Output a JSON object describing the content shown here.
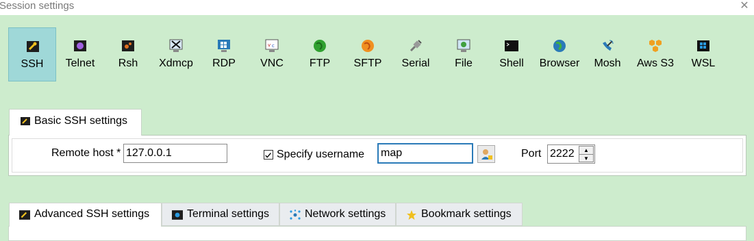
{
  "window": {
    "title": "Session settings",
    "close_glyph": "✕"
  },
  "session_types": [
    {
      "label": "SSH",
      "icon": "ssh-key-icon",
      "active": true
    },
    {
      "label": "Telnet",
      "icon": "telnet-icon"
    },
    {
      "label": "Rsh",
      "icon": "rsh-icon"
    },
    {
      "label": "Xdmcp",
      "icon": "xdmcp-icon"
    },
    {
      "label": "RDP",
      "icon": "rdp-icon"
    },
    {
      "label": "VNC",
      "icon": "vnc-icon"
    },
    {
      "label": "FTP",
      "icon": "ftp-globe-icon"
    },
    {
      "label": "SFTP",
      "icon": "sftp-icon"
    },
    {
      "label": "Serial",
      "icon": "serial-plug-icon"
    },
    {
      "label": "File",
      "icon": "file-monitor-icon"
    },
    {
      "label": "Shell",
      "icon": "shell-terminal-icon"
    },
    {
      "label": "Browser",
      "icon": "browser-globe-icon"
    },
    {
      "label": "Mosh",
      "icon": "mosh-satellite-icon"
    },
    {
      "label": "Aws S3",
      "icon": "aws-s3-icon"
    },
    {
      "label": "WSL",
      "icon": "wsl-windows-icon"
    }
  ],
  "basic_tab": {
    "label": "Basic SSH settings",
    "icon": "ssh-key-icon"
  },
  "basic": {
    "remote_host_label": "Remote host *",
    "remote_host_value": "127.0.0.1",
    "specify_username_label": "Specify username",
    "specify_username_checked": true,
    "username_value": "map",
    "port_label": "Port",
    "port_value": "2222"
  },
  "bottom_tabs": [
    {
      "label": "Advanced SSH settings",
      "icon": "ssh-key-icon"
    },
    {
      "label": "Terminal settings",
      "icon": "terminal-icon"
    },
    {
      "label": "Network settings",
      "icon": "network-icon"
    },
    {
      "label": "Bookmark settings",
      "icon": "star-icon"
    }
  ],
  "colors": {
    "background": "#cdeccd",
    "active_tool": "#9fd8d8",
    "accent_blue": "#2a7ab8"
  }
}
